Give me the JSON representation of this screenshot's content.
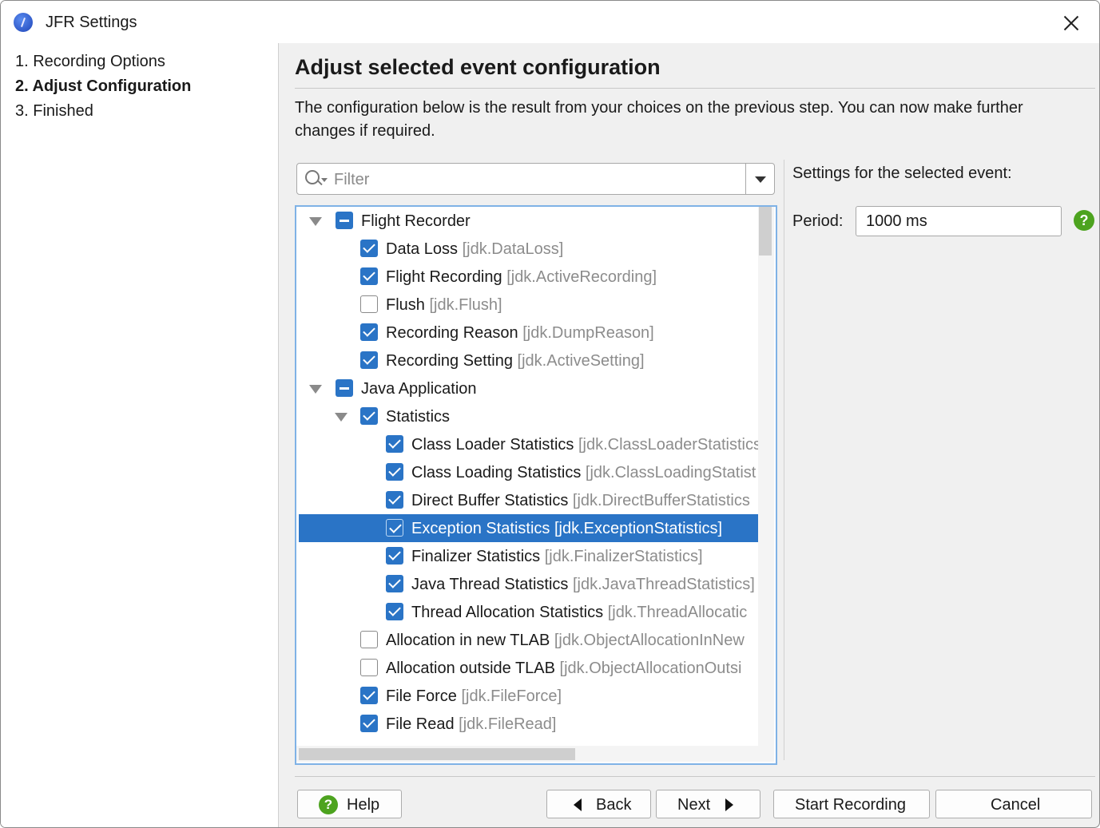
{
  "window": {
    "title": "JFR Settings"
  },
  "steps": [
    "1. Recording Options",
    "2. Adjust Configuration",
    "3. Finished"
  ],
  "active_step": 1,
  "heading": "Adjust selected event configuration",
  "description": "The configuration below is the result from your choices on the previous step. You can now make further changes if required.",
  "filter": {
    "placeholder": "Filter",
    "value": ""
  },
  "tree": [
    {
      "label": "Flight Recorder",
      "key": "",
      "level": 0,
      "expander": "expanded",
      "check": "partial",
      "selected": false
    },
    {
      "label": "Data Loss",
      "key": "[jdk.DataLoss]",
      "level": 1,
      "expander": "none",
      "check": "checked",
      "selected": false
    },
    {
      "label": "Flight Recording",
      "key": "[jdk.ActiveRecording]",
      "level": 1,
      "expander": "none",
      "check": "checked",
      "selected": false
    },
    {
      "label": "Flush",
      "key": "[jdk.Flush]",
      "level": 1,
      "expander": "none",
      "check": "unchecked",
      "selected": false
    },
    {
      "label": "Recording Reason",
      "key": "[jdk.DumpReason]",
      "level": 1,
      "expander": "none",
      "check": "checked",
      "selected": false
    },
    {
      "label": "Recording Setting",
      "key": "[jdk.ActiveSetting]",
      "level": 1,
      "expander": "none",
      "check": "checked",
      "selected": false
    },
    {
      "label": "Java Application",
      "key": "",
      "level": 0,
      "expander": "expanded",
      "check": "partial",
      "selected": false
    },
    {
      "label": "Statistics",
      "key": "",
      "level": 1,
      "expander": "expanded",
      "check": "checked",
      "selected": false
    },
    {
      "label": "Class Loader Statistics",
      "key": "[jdk.ClassLoaderStatistics",
      "level": 2,
      "expander": "none",
      "check": "checked",
      "selected": false
    },
    {
      "label": "Class Loading Statistics",
      "key": "[jdk.ClassLoadingStatist",
      "level": 2,
      "expander": "none",
      "check": "checked",
      "selected": false
    },
    {
      "label": "Direct Buffer Statistics",
      "key": "[jdk.DirectBufferStatistics",
      "level": 2,
      "expander": "none",
      "check": "checked",
      "selected": false
    },
    {
      "label": "Exception Statistics",
      "key": "[jdk.ExceptionStatistics]",
      "level": 2,
      "expander": "none",
      "check": "checked",
      "selected": true
    },
    {
      "label": "Finalizer Statistics",
      "key": "[jdk.FinalizerStatistics]",
      "level": 2,
      "expander": "none",
      "check": "checked",
      "selected": false
    },
    {
      "label": "Java Thread Statistics",
      "key": "[jdk.JavaThreadStatistics]",
      "level": 2,
      "expander": "none",
      "check": "checked",
      "selected": false
    },
    {
      "label": "Thread Allocation Statistics",
      "key": "[jdk.ThreadAllocatic",
      "level": 2,
      "expander": "none",
      "check": "checked",
      "selected": false
    },
    {
      "label": "Allocation in new TLAB",
      "key": "[jdk.ObjectAllocationInNew",
      "level": 1,
      "expander": "none",
      "check": "unchecked",
      "selected": false
    },
    {
      "label": "Allocation outside TLAB",
      "key": "[jdk.ObjectAllocationOutsi",
      "level": 1,
      "expander": "none",
      "check": "unchecked",
      "selected": false
    },
    {
      "label": "File Force",
      "key": "[jdk.FileForce]",
      "level": 1,
      "expander": "none",
      "check": "checked",
      "selected": false
    },
    {
      "label": "File Read",
      "key": "[jdk.FileRead]",
      "level": 1,
      "expander": "none",
      "check": "checked",
      "selected": false
    }
  ],
  "settings": {
    "title": "Settings for the selected event:",
    "period_label": "Period:",
    "period_value": "1000 ms"
  },
  "buttons": {
    "help": "Help",
    "back": "Back",
    "next": "Next",
    "start": "Start Recording",
    "cancel": "Cancel"
  },
  "colors": {
    "selection": "#2a74c6",
    "check": "#2a74c6",
    "help_green": "#4da31f",
    "tree_focus_border": "#7fb2e6"
  },
  "icons": {
    "app": "jfr-app-icon",
    "close": "close-icon",
    "filter": "search-icon",
    "help": "help-icon"
  }
}
